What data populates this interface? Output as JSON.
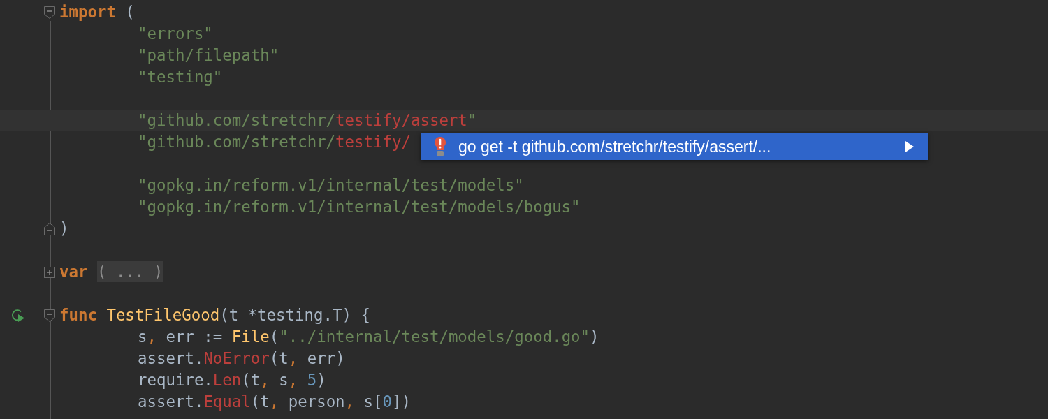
{
  "editor": {
    "lines": [
      {
        "kind": "fold-start",
        "indented": false,
        "current": false,
        "tokens": [
          {
            "kind": "keyword",
            "text": "import"
          },
          {
            "kind": "plain",
            "text": " ("
          }
        ]
      },
      {
        "kind": "plain",
        "indented": true,
        "current": false,
        "tokens": [
          {
            "kind": "string",
            "text": "\"errors\""
          }
        ]
      },
      {
        "kind": "plain",
        "indented": true,
        "current": false,
        "tokens": [
          {
            "kind": "string",
            "text": "\"path/filepath\""
          }
        ]
      },
      {
        "kind": "plain",
        "indented": true,
        "current": false,
        "tokens": [
          {
            "kind": "string",
            "text": "\"testing\""
          }
        ]
      },
      {
        "kind": "plain",
        "current": false
      },
      {
        "kind": "plain",
        "indented": true,
        "current": true,
        "tokens": [
          {
            "kind": "string",
            "text": "\"github.com/stretchr/"
          },
          {
            "kind": "error",
            "text": "testify/assert"
          },
          {
            "kind": "string",
            "text": "\""
          }
        ]
      },
      {
        "kind": "plain",
        "indented": true,
        "current": false,
        "tokens": [
          {
            "kind": "string",
            "text": "\"github.com/stretchr/"
          },
          {
            "kind": "error",
            "text": "testify/"
          }
        ]
      },
      {
        "kind": "plain",
        "current": false
      },
      {
        "kind": "plain",
        "indented": true,
        "current": false,
        "tokens": [
          {
            "kind": "string",
            "text": "\"gopkg.in/reform.v1/internal/test/models\""
          }
        ]
      },
      {
        "kind": "plain",
        "indented": true,
        "current": false,
        "tokens": [
          {
            "kind": "string",
            "text": "\"gopkg.in/reform.v1/internal/test/models/bogus\""
          }
        ]
      },
      {
        "kind": "fold-end",
        "indented": false,
        "current": false,
        "tokens": [
          {
            "kind": "plain",
            "text": ")"
          }
        ]
      },
      {
        "kind": "plain",
        "current": false
      },
      {
        "kind": "fold-collapsed",
        "indented": false,
        "current": false,
        "tokens": [
          {
            "kind": "keyword",
            "text": "var "
          },
          {
            "kind": "folded",
            "text": "( ... )"
          }
        ]
      },
      {
        "kind": "plain",
        "current": false
      },
      {
        "kind": "fold-start-run",
        "indented": false,
        "current": false,
        "tokens": [
          {
            "kind": "keyword",
            "text": "func "
          },
          {
            "kind": "function",
            "text": "TestFileGood"
          },
          {
            "kind": "plain",
            "text": "(t *testing.T) {"
          }
        ]
      },
      {
        "kind": "plain",
        "indented": true,
        "current": false,
        "tokens": [
          {
            "kind": "plain",
            "text": "s"
          },
          {
            "kind": "comma",
            "text": ", "
          },
          {
            "kind": "plain",
            "text": "err := "
          },
          {
            "kind": "function",
            "text": "File"
          },
          {
            "kind": "plain",
            "text": "("
          },
          {
            "kind": "string",
            "text": "\"../internal/test/models/good.go\""
          },
          {
            "kind": "plain",
            "text": ")"
          }
        ]
      },
      {
        "kind": "plain",
        "indented": true,
        "current": false,
        "tokens": [
          {
            "kind": "plain",
            "text": "assert."
          },
          {
            "kind": "error",
            "text": "NoError"
          },
          {
            "kind": "plain",
            "text": "(t"
          },
          {
            "kind": "comma",
            "text": ", "
          },
          {
            "kind": "plain",
            "text": "err)"
          }
        ]
      },
      {
        "kind": "plain",
        "indented": true,
        "current": false,
        "tokens": [
          {
            "kind": "plain",
            "text": "require."
          },
          {
            "kind": "error",
            "text": "Len"
          },
          {
            "kind": "plain",
            "text": "(t"
          },
          {
            "kind": "comma",
            "text": ", "
          },
          {
            "kind": "plain",
            "text": "s"
          },
          {
            "kind": "comma",
            "text": ", "
          },
          {
            "kind": "number",
            "text": "5"
          },
          {
            "kind": "plain",
            "text": ")"
          }
        ]
      },
      {
        "kind": "plain",
        "indented": true,
        "current": false,
        "tokens": [
          {
            "kind": "plain",
            "text": "assert."
          },
          {
            "kind": "error",
            "text": "Equal"
          },
          {
            "kind": "plain",
            "text": "(t"
          },
          {
            "kind": "comma",
            "text": ", "
          },
          {
            "kind": "plain",
            "text": "person"
          },
          {
            "kind": "comma",
            "text": ", "
          },
          {
            "kind": "plain",
            "text": "s["
          },
          {
            "kind": "number",
            "text": "0"
          },
          {
            "kind": "plain",
            "text": "])"
          }
        ]
      }
    ]
  },
  "intention_popup": {
    "items": [
      {
        "text": "go get -t github.com/stretchr/testify/assert/...",
        "selected": true,
        "has_submenu": true
      }
    ]
  }
}
